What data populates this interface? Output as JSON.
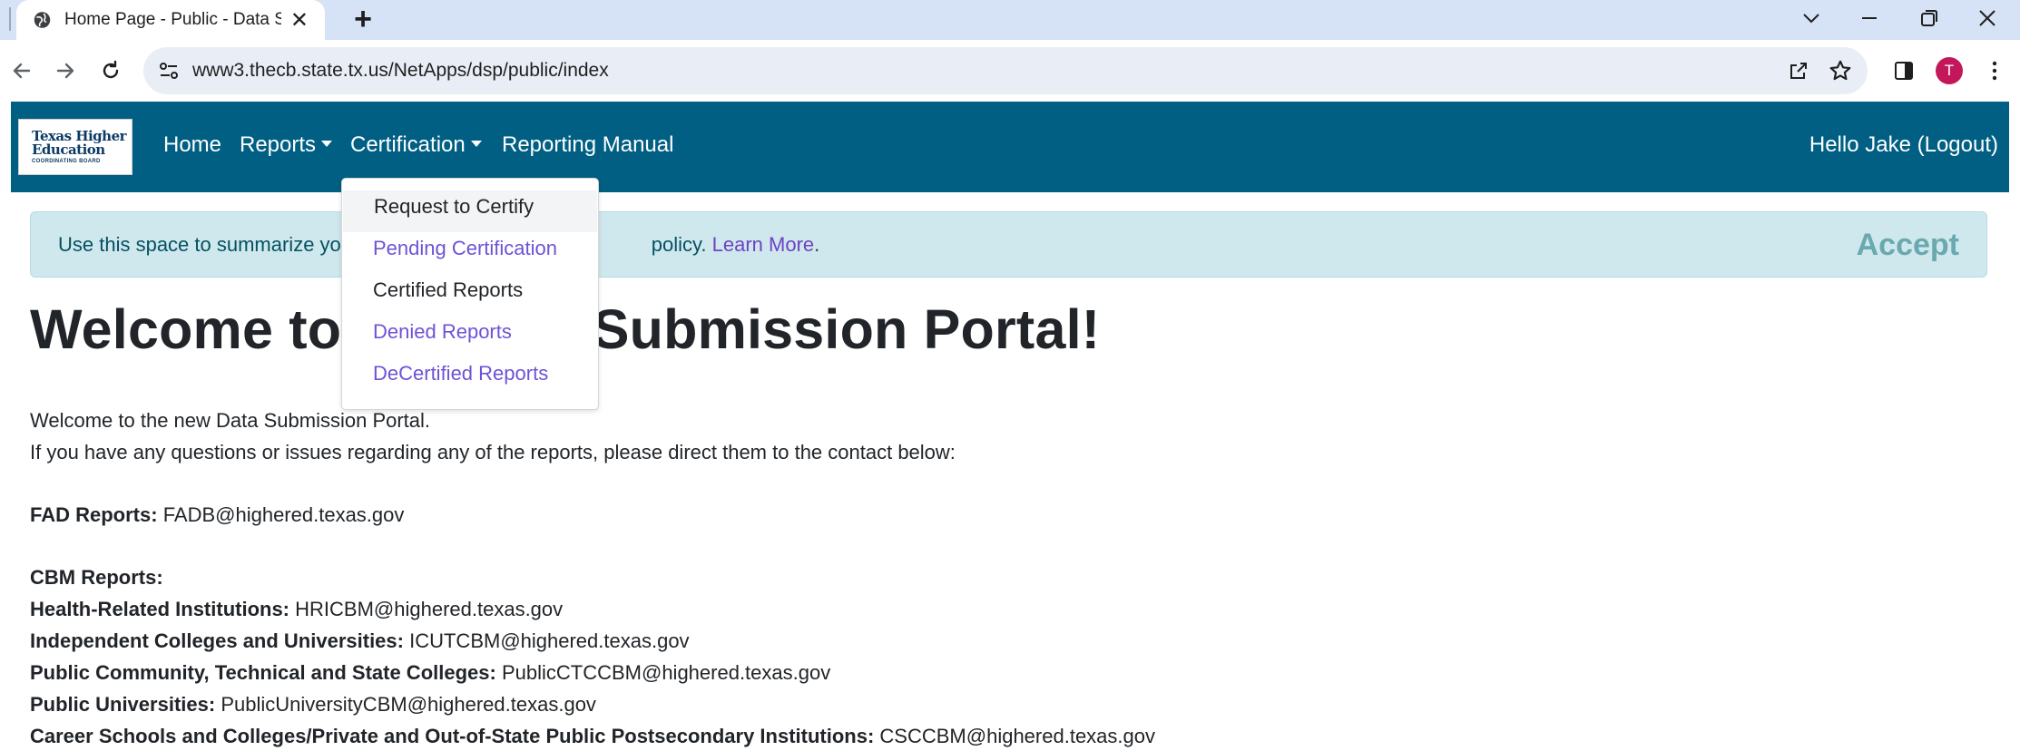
{
  "browser": {
    "tab_title": "Home Page - Public - Data Submi",
    "tab_close": "✕",
    "new_tab": "+",
    "url": "www3.thecb.state.tx.us/NetApps/dsp/public/index",
    "profile_initial": "T",
    "profile_color": "#c2185b"
  },
  "navbar": {
    "logo": {
      "line1": "Texas Higher",
      "line2": "Education",
      "line3": "COORDINATING BOARD"
    },
    "links": {
      "home": "Home",
      "reports": "Reports",
      "certification": "Certification",
      "manual": "Reporting Manual"
    },
    "user_greeting": "Hello Jake (Logout)",
    "color": "#005f83"
  },
  "dropdown": {
    "items": [
      "Request to Certify",
      "Pending Certification",
      "Certified Reports",
      "Denied Reports",
      "DeCertified Reports"
    ]
  },
  "banner": {
    "message_start": "Use this space to summarize yo",
    "message_end": "policy. ",
    "learn_more": "Learn More",
    "period": ".",
    "accept": "Accept"
  },
  "main": {
    "title": "Welcome to the Data Submission Portal!",
    "intro": "Welcome to the new Data Submission Portal.",
    "questions": "If you have any questions or issues regarding any of the reports, please direct them to the contact below:",
    "fad": {
      "label": "FAD Reports:",
      "email": "FADB@highered.texas.gov"
    },
    "cbm_heading": "CBM Reports:",
    "contacts": [
      {
        "label": "Health-Related Institutions:",
        "email": "HRICBM@highered.texas.gov"
      },
      {
        "label": "Independent Colleges and Universities:",
        "email": "ICUTCBM@highered.texas.gov"
      },
      {
        "label": "Public Community, Technical and State Colleges:",
        "email": "PublicCTCCBM@highered.texas.gov"
      },
      {
        "label": "Public Universities:",
        "email": "PublicUniversityCBM@highered.texas.gov"
      },
      {
        "label": "Career Schools and Colleges/Private and Out-of-State Public Postsecondary Institutions:",
        "email": "CSCCBM@highered.texas.gov"
      }
    ]
  }
}
